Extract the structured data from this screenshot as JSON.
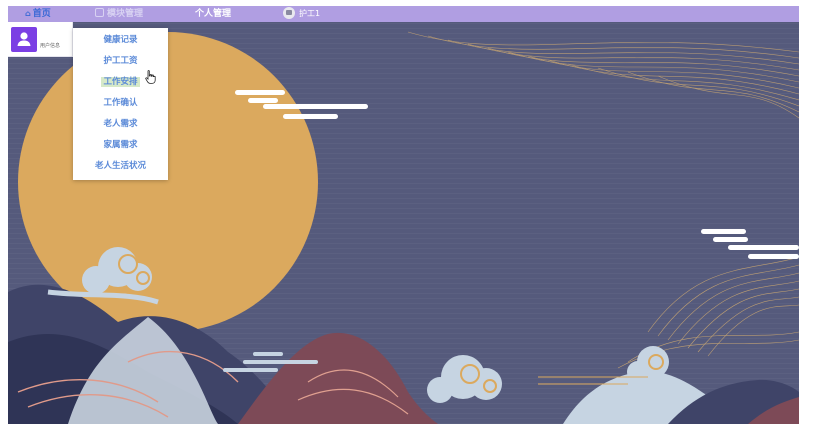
{
  "navbar": {
    "home_label": "首页",
    "module_label": "模块管理",
    "personal_label": "个人管理",
    "user_label": "护工1"
  },
  "userbox": {
    "label": "用户信息"
  },
  "dropdown": {
    "items": [
      {
        "label": "健康记录"
      },
      {
        "label": "护工工资"
      },
      {
        "label": "工作安排"
      },
      {
        "label": "工作确认"
      },
      {
        "label": "老人需求"
      },
      {
        "label": "家属需求"
      },
      {
        "label": "老人生活状况"
      }
    ],
    "active_index": 2
  },
  "colors": {
    "navbar_bg": "#b09ee2",
    "background": "#555a7c",
    "moon": "#dba95e",
    "dropdown_text": "#5b8ad8",
    "accent_purple": "#7b3fe4"
  },
  "icons": {
    "home": "home-icon",
    "module": "grid-icon",
    "user": "user-icon",
    "avatar": "avatar-icon",
    "cursor": "hand-cursor-icon"
  }
}
